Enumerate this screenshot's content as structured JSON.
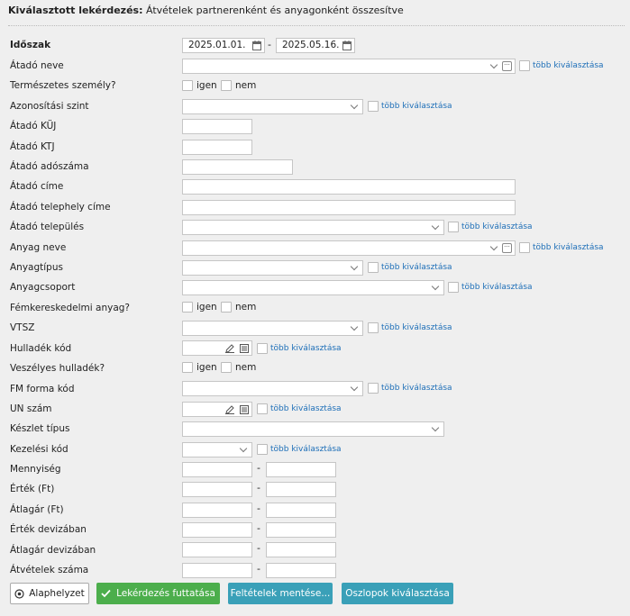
{
  "header": {
    "prefix": "Kiválasztott lekérdezés:",
    "title": "Átvételek partnerenként és anyagonként összesítve"
  },
  "labels": {
    "idoszak": "Időszak",
    "atado_neve": "Átadó neve",
    "termeszetes": "Természetes személy?",
    "azon_szint": "Azonosítási szint",
    "kuj": "Átadó KÜJ",
    "ktj": "Átadó KTJ",
    "adoszam": "Átadó adószáma",
    "cim": "Átadó címe",
    "telephely": "Átadó telephely címe",
    "telepules": "Átadó település",
    "anyag_neve": "Anyag neve",
    "anyagtipus": "Anyagtípus",
    "anyagcsoport": "Anyagcsoport",
    "femker": "Fémkereskedelmi anyag?",
    "vtsz": "VTSZ",
    "hull_kod": "Hulladék kód",
    "veszelyes": "Veszélyes hulladék?",
    "fm_forma": "FM forma kód",
    "un_szam": "UN szám",
    "keszlet": "Készlet típus",
    "kezelesi": "Kezelési kód",
    "mennyiseg": "Mennyiség",
    "ertek": "Érték (Ft)",
    "atlagar": "Átlagár (Ft)",
    "ertek_dev": "Érték devizában",
    "atlagar_dev": "Átlagár devizában",
    "atvetelek": "Átvételek száma"
  },
  "dates": {
    "from": "2025.01.01.",
    "to": "2025.05.16.",
    "sep": "-"
  },
  "common": {
    "multi": "több kiválasztása",
    "igen": "igen",
    "nem": "nem",
    "dash": "-"
  },
  "buttons": {
    "reset": "Alaphelyzet",
    "run": "Lekérdezés futtatása",
    "save": "Feltételek mentése...",
    "columns": "Oszlopok kiválasztása"
  }
}
